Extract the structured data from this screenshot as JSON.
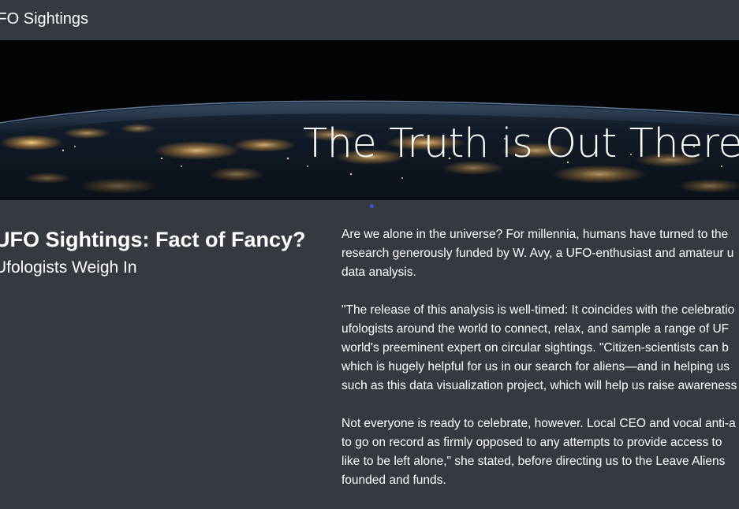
{
  "navbar": {
    "brand": "UFO Sightings"
  },
  "hero": {
    "title": "The Truth is Out There"
  },
  "article": {
    "title": "UFO Sightings: Fact of Fancy?",
    "subtitle": "Ufologists Weigh In",
    "paragraphs": [
      {
        "lines": [
          "Are we alone in the universe? For millennia, humans have turned to the",
          "research generously funded by W. Avy, a UFO-enthusiast and amateur u",
          "data analysis."
        ]
      },
      {
        "lines": [
          "\"The release of this analysis is well-timed: It coincides with the celebratio",
          "ufologists around the world to connect, relax, and sample a range of UF",
          "world's preeminent expert on circular sightings. \"Citizen-scientists can b",
          "which is hugely helpful for us in our search for aliens—and in helping us",
          "such as this data visualization project, which will help us raise awareness"
        ]
      },
      {
        "lines": [
          "Not everyone is ready to celebrate, however. Local CEO and vocal anti-a",
          "to go on record as firmly opposed to any attempts to provide access to",
          "like to be left alone,\" she stated, before directing us to the Leave Aliens",
          "founded and funds."
        ]
      }
    ]
  },
  "colors": {
    "background": "#343a40",
    "text": "#ffffff",
    "carousel_indicator": "#3f51d8"
  }
}
